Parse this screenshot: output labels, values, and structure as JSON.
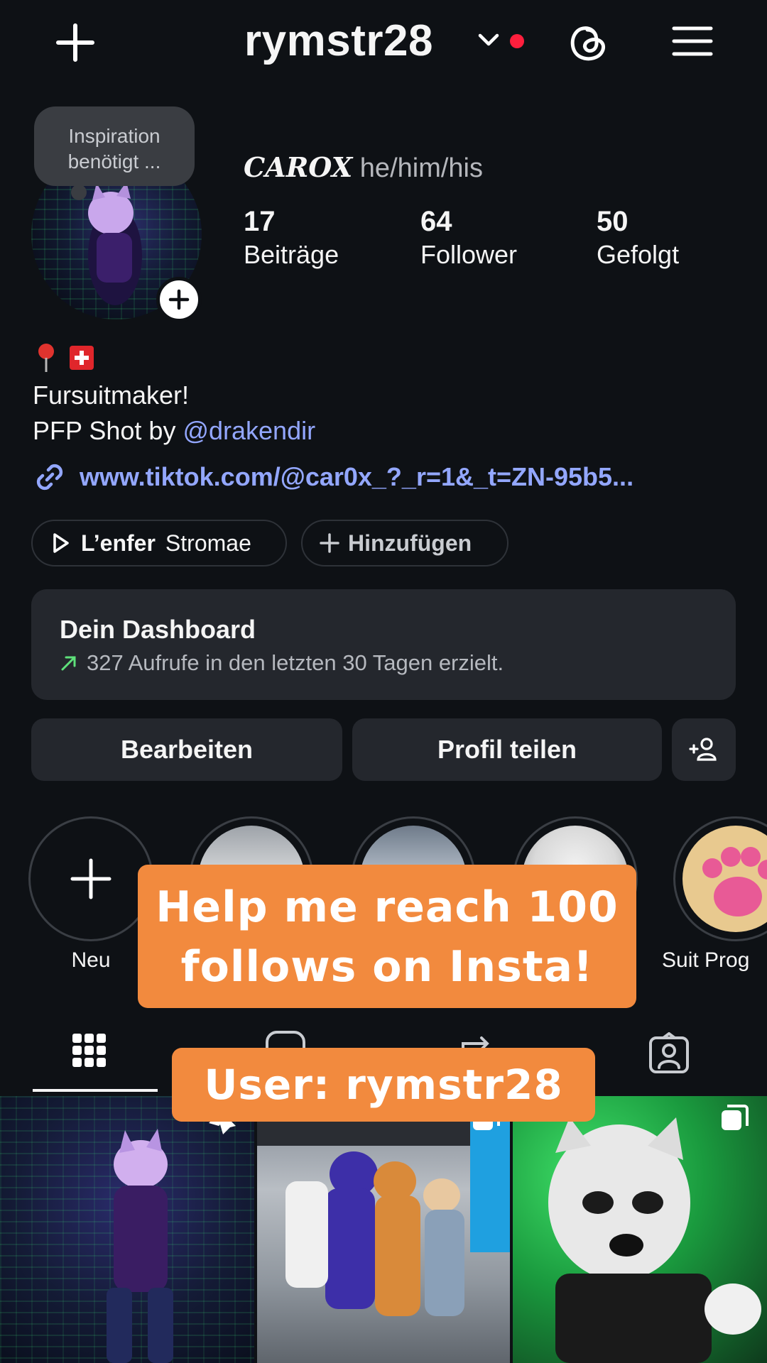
{
  "header": {
    "username": "rymstr28",
    "icons": {
      "create": "plus-icon",
      "switcher": "chevron-down-icon",
      "threads": "threads-icon",
      "menu": "hamburger-menu-icon"
    }
  },
  "profile": {
    "note": "Inspiration benötigt ...",
    "name": "CAROX",
    "pronouns": "he/him/his",
    "stats": [
      {
        "value": "17",
        "label": "Beiträge"
      },
      {
        "value": "64",
        "label": "Follower"
      },
      {
        "value": "50",
        "label": "Gefolgt"
      }
    ],
    "bio": {
      "emojis": [
        "📍",
        "🇨🇭"
      ],
      "line1": "Fursuitmaker!",
      "line2_prefix": "PFP Shot by ",
      "mention": "@drakendir",
      "link": "www.tiktok.com/@car0x_?_r=1&_t=ZN-95b5..."
    },
    "music": {
      "title": "L’enfer",
      "artist": "Stromae"
    },
    "add_button": "Hinzufügen"
  },
  "dashboard": {
    "title": "Dein Dashboard",
    "subtitle": "327 Aufrufe in den letzten 30 Tagen erzielt.",
    "accent": "#5ee07a"
  },
  "actions": {
    "edit": "Bearbeiten",
    "share": "Profil teilen"
  },
  "highlights": [
    {
      "label": "Neu"
    },
    {
      "label": ""
    },
    {
      "label": ""
    },
    {
      "label": ""
    },
    {
      "label": "Suit Prog"
    }
  ],
  "tabs": [
    "grid-icon",
    "reels-icon",
    "reposts-icon",
    "tagged-icon"
  ],
  "overlay": {
    "line1": "Help me reach 100",
    "line2": "follows on Insta!",
    "user": "User: rymstr28",
    "color": "#f28a3e"
  }
}
